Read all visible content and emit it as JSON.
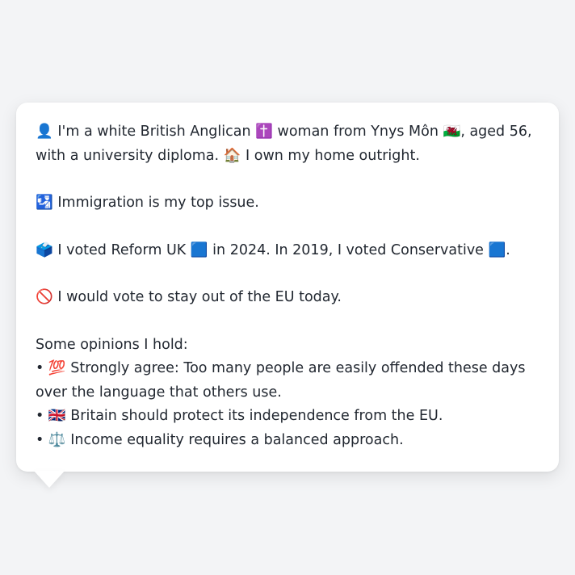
{
  "profile": {
    "intro": {
      "icon": "👤",
      "text1": " I'm a white British Anglican ",
      "religion_icon": "✝️",
      "text2": " woman from Ynys Môn ",
      "region_icon": "🏴󠁧󠁢󠁷󠁬󠁳󠁿",
      "text3": ", aged 56, with a university diploma. ",
      "home_icon": "🏠",
      "text4": " I own my home outright."
    },
    "issue": {
      "icon": "🛂",
      "text": " Immigration is my top issue."
    },
    "vote": {
      "icon": "🗳️",
      "text1": " I voted Reform UK ",
      "party_icon_2024": "🟦",
      "text2": " in 2024. In 2019, I voted Conservative ",
      "party_icon_2019": "🟦",
      "text3": "."
    },
    "eu": {
      "icon": "🚫",
      "text": " I would vote to stay out of the EU today."
    },
    "opinions": {
      "heading": "Some opinions I hold:",
      "bullet": "•",
      "items": [
        {
          "icon": "💯",
          "text": " Strongly agree: Too many people are easily offended these days over the language that others use."
        },
        {
          "icon": "🇬🇧",
          "text": " Britain should protect its independence from the EU."
        },
        {
          "icon": "⚖️",
          "text": " Income equality requires a balanced approach."
        }
      ]
    }
  }
}
